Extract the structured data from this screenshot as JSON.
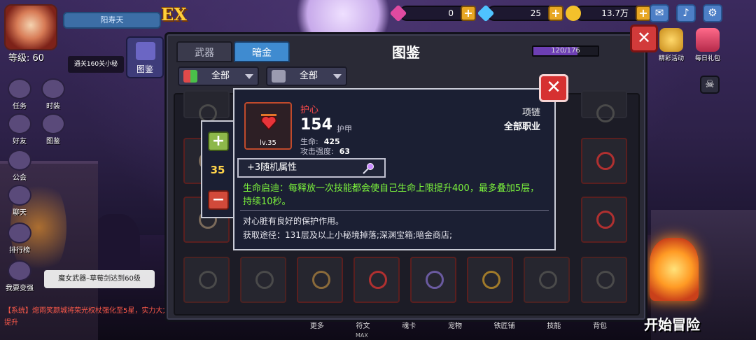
{
  "hud": {
    "player_level": "等级: 60",
    "player_name": "阳寿天",
    "logo_text": "EX",
    "currencies": [
      {
        "name": "pink-gem",
        "value": "0",
        "color": "#e04aa0"
      },
      {
        "name": "diamond",
        "value": "25",
        "color": "#4fc3ff"
      },
      {
        "name": "gold-coin",
        "value": "13.7万",
        "color": "#f3c12b"
      }
    ],
    "top_buttons": [
      "mail-icon",
      "speaker-icon",
      "gear-icon"
    ],
    "top_right_items": [
      {
        "label": "精彩活动",
        "icon": "medal-icon"
      },
      {
        "label": "每日礼包",
        "icon": "gift-icon"
      }
    ]
  },
  "left_menu": {
    "quest_tip": "通关160关小秘",
    "buttons": [
      "任务",
      "时装",
      "好友",
      "图鉴",
      "公会",
      "聊天",
      "排行榜",
      "我要变强"
    ],
    "atlas_label": "图鉴",
    "promo_tip": "魔女武器–草莓剑达到60级",
    "system_message": "【系统】熄雨笑颜城将荣光权杖强化至5星，实力大大提升"
  },
  "bottom": {
    "start_button": "开始冒险",
    "nav": [
      "更多",
      "符文",
      "魂卡",
      "宠物",
      "铁匠铺",
      "技能",
      "背包"
    ],
    "max_label": "MAX"
  },
  "panel": {
    "title": "图鉴",
    "tabs": [
      {
        "label": "武器",
        "active": false
      },
      {
        "label": "暗金",
        "active": true
      }
    ],
    "progress_text": "120/176",
    "progress_fraction": 0.68,
    "filters": [
      {
        "label": "全部",
        "icon": "class-icon"
      },
      {
        "label": "全部",
        "icon": "monster-icon"
      }
    ],
    "close_label": "✕"
  },
  "tooltip": {
    "close_label": "✕",
    "item": {
      "name": "护心",
      "score": "154",
      "score_label": "护甲",
      "level": "lv.35",
      "type": "项链",
      "class": "全部职业",
      "icon": "heart-amulet-icon",
      "name_color": "#ff4b4b"
    },
    "stats": [
      {
        "label": "生命:",
        "value": "425"
      },
      {
        "label": "攻击强度:",
        "value": "63"
      }
    ],
    "random_attribute": "+3随机属性",
    "passive": "生命启迪：每释放一次技能都会使自己生命上限提升400，最多叠加5层，持续10秒。",
    "description": "对心脏有良好的保护作用。",
    "source": "获取途径：131层及以上小秘境掉落;深渊宝箱;暗金商店;"
  },
  "stepper": {
    "value": "35",
    "plus_label": "+",
    "minus_label": "−"
  }
}
